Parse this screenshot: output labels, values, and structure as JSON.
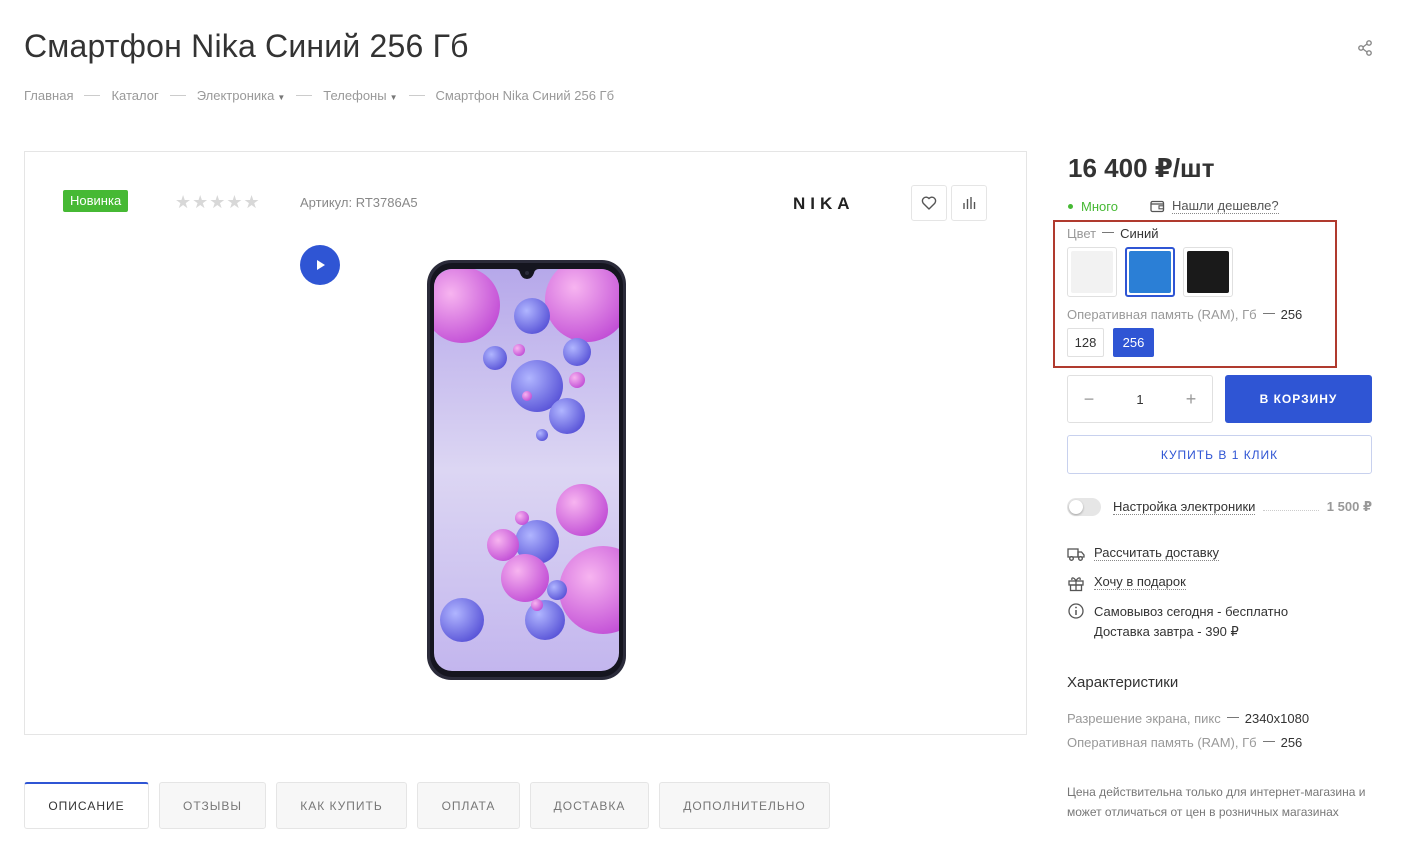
{
  "page": {
    "title": "Смартфон Nika Синий 256 Гб"
  },
  "breadcrumb": {
    "items": [
      "Главная",
      "Каталог",
      "Электроника",
      "Телефоны",
      "Смартфон Nika Синий 256 Гб"
    ]
  },
  "gallery": {
    "badge": "Новинка",
    "stars": "★★★★★",
    "rating": 0,
    "article": "Артикул: RT3786A5",
    "brand": "NIKA"
  },
  "offer": {
    "price": "16 400 ₽/шт",
    "stock": "Много",
    "cheaper_link": "Нашли дешевле?"
  },
  "sku": {
    "color_label": "Цвет",
    "color_value": "Синий",
    "colors": [
      {
        "name": "white",
        "hex": "#f2f2f2"
      },
      {
        "name": "blue",
        "hex": "#2b7fd6"
      },
      {
        "name": "black",
        "hex": "#1a1a1a"
      }
    ],
    "ram_label": "Оперативная память (RAM), Гб",
    "ram_value": "256",
    "ram_options": [
      "128",
      "256"
    ]
  },
  "cart": {
    "quantity": "1",
    "minus": "−",
    "plus": "+",
    "add_label": "В КОРЗИНУ",
    "oneclick_label": "КУПИТЬ В 1 КЛИК"
  },
  "service": {
    "name": "Настройка электроники",
    "price": "1 500 ₽"
  },
  "delivery": {
    "calc_link": "Рассчитать доставку",
    "gift_link": "Хочу в подарок",
    "pickup": "Самовывоз сегодня - бесплатно",
    "delivery": "Доставка завтра - 390 ₽"
  },
  "characteristics": {
    "title": "Характеристики",
    "rows": [
      {
        "label": "Разрешение экрана, пикс",
        "value": "2340x1080"
      },
      {
        "label": "Оперативная память (RAM), Гб",
        "value": "256"
      }
    ],
    "note": "Цена действительна только для интернет-магазина и может отличаться от цен в розничных магазинах"
  },
  "tabs": [
    "ОПИСАНИЕ",
    "ОТЗЫВЫ",
    "КАК КУПИТЬ",
    "ОПЛАТА",
    "ДОСТАВКА",
    "ДОПОЛНИТЕЛЬНО"
  ],
  "colors": {
    "accent": "#2f55d4",
    "new_badge": "#46b934",
    "highlight_box": "#b03a2e"
  }
}
